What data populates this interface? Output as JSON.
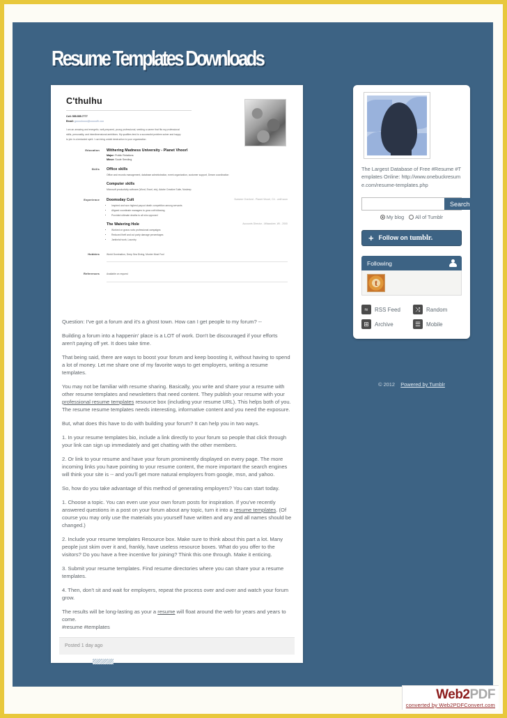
{
  "site": {
    "title": "Resume Templates Downloads",
    "panel_color": "#3d6384",
    "page_border_color": "#e8c83c"
  },
  "resume": {
    "name": "C'thulhu",
    "phone": "Cell: 555.555.7777",
    "email_label": "Email:",
    "email": "gooooloooo@ooooofh.coo",
    "summary": "I am an amazing and energetic, well-prepared, young professional, seeking a career that fits my professional skills, personality, and interdimensional ambitions. My qualities lend to a successful problem solver and happy to join in a tentacled spirit. I can bring untold destruction to your organization.",
    "sections": [
      {
        "label": "Education",
        "heading": "Withering Madness University - Planet Vhoorl",
        "sub1_key": "Major:",
        "sub1_val": "Public Relations",
        "sub2_key": "Minor:",
        "sub2_val": "Soule Sending"
      },
      {
        "label": "Skills",
        "heading": "Office skills",
        "para": "Office and records management, database administration, event organization, customer support, Dream coordination",
        "heading2": "Computer skills",
        "para2": "Microsoft productivity software (Word, Excel, etc), Adobe Creative Suite, Nosleep"
      },
      {
        "label": "Experience",
        "heading": "Doomsday Cult",
        "date": "Summer Overlord - Planet Vhoorl, C4 - until soon",
        "bullets": [
          "Inspired and won highest payout death competition among servants",
          "Aligned coordinate managers to grow cult following",
          "Provided ultimate deaths to all who opposed"
        ]
      },
      {
        "label": "",
        "heading": "The Watering Hole",
        "date": "Accounts Director - Milwaukee, WI - 2000",
        "bullets": [
          "Worked on grass roots professional campaigns",
          "Reduced theft and cut party damage percentages",
          "Janitorial work, Laundry"
        ]
      },
      {
        "label": "Hobbies",
        "para": "World Domination, Deep Sea Diving, Murder Most Foul"
      },
      {
        "label": "References",
        "para": "Available on request"
      }
    ]
  },
  "post": {
    "paragraphs": [
      "Question: I've got a forum and it's a ghost town. How can I get people to my forum? --",
      "Building a forum into a happenin' place is a LOT of work. Don't be discouraged if your efforts aren't paying off yet. It does take time.",
      "That being said, there are ways to boost your forum and keep boosting it, without having to spend a lot of money. Let me share one of my favorite ways to get employers, writing a resume templates.",
      "You may not be familiar with resume sharing. Basically, you write and share your a resume with other resume templates and newsletters that need content. They publish your resume with your professional resume templates resource box (including your resume URL). This helps both of you. The resume resume templates needs interesting, informative content and you need the exposure.",
      "But, what does this have to do with building your forum? It can help you in two ways.",
      "1. In your resume templates bio, include a link directly to your forum so people that click through your link can sign up immediately and get chatting with the other members.",
      "2. Or link to your resume and have your forum prominently displayed on every page. The more incoming links you have pointing to your resume content, the more important the search engines will think your site is -- and you'll get more natural employers from google, msn, and yahoo.",
      "So, how do you take advantage of this method of generating employers? You can start today.",
      "1. Choose a topic. You can even use your own forum posts for inspiration. If you've recently answered questions in a post on your forum about any topic, turn it into a resume templates. (Of course you may only use the materials you yourself have written and any and all names should be changed.)",
      "2. Include your resume templates Resource box. Make sure to think about this part a lot. Many people just skim over it and, frankly, have useless resource boxes. What do you offer to the visitors? Do you have a free incentive for joining? Think this one through. Make it enticing.",
      "3. Submit your resume templates. Find resume directories where you can share your a resume templates.",
      "4. Then, don't sit and wait for employers, repeat the process over and over and watch your forum grow.",
      "The results will be long-lasting as your a resume will float around the web for years and years to come. #resume #templates"
    ],
    "links": {
      "link1": "professional resume templates",
      "link2": "resume templates",
      "link3": "resume"
    },
    "footer": "Posted 1 day ago"
  },
  "sidebar": {
    "avatar_alt": "head-silhouette-avatar",
    "description": "The Largest Database of Free #Resume #Templates Online: http://www.onebuckresume.com/resume-templates.php",
    "search": {
      "value": "",
      "placeholder": "",
      "button_label": "Search",
      "scope_my_blog": "My blog",
      "scope_all_tumblr": "All of Tumblr",
      "selected_scope": "My blog"
    },
    "follow_button": {
      "plus": "+",
      "label": "Follow on ",
      "brand": "tumblr."
    },
    "following": {
      "title": "Following",
      "avatar_letter": "t"
    },
    "links": [
      {
        "label": "RSS Feed",
        "icon": "rss-icon",
        "glyph": "≈"
      },
      {
        "label": "Random",
        "icon": "shuffle-icon",
        "glyph": "⤨"
      },
      {
        "label": "Archive",
        "icon": "archive-icon",
        "glyph": "⊞"
      },
      {
        "label": "Mobile",
        "icon": "mobile-icon",
        "glyph": "☰"
      }
    ],
    "copyright": "© 2012",
    "powered_by": "Powered by Tumblr"
  },
  "watermark": {
    "part1": "Web2",
    "part2": "PDF",
    "subtitle": "converted by Web2PDFConvert.com"
  }
}
